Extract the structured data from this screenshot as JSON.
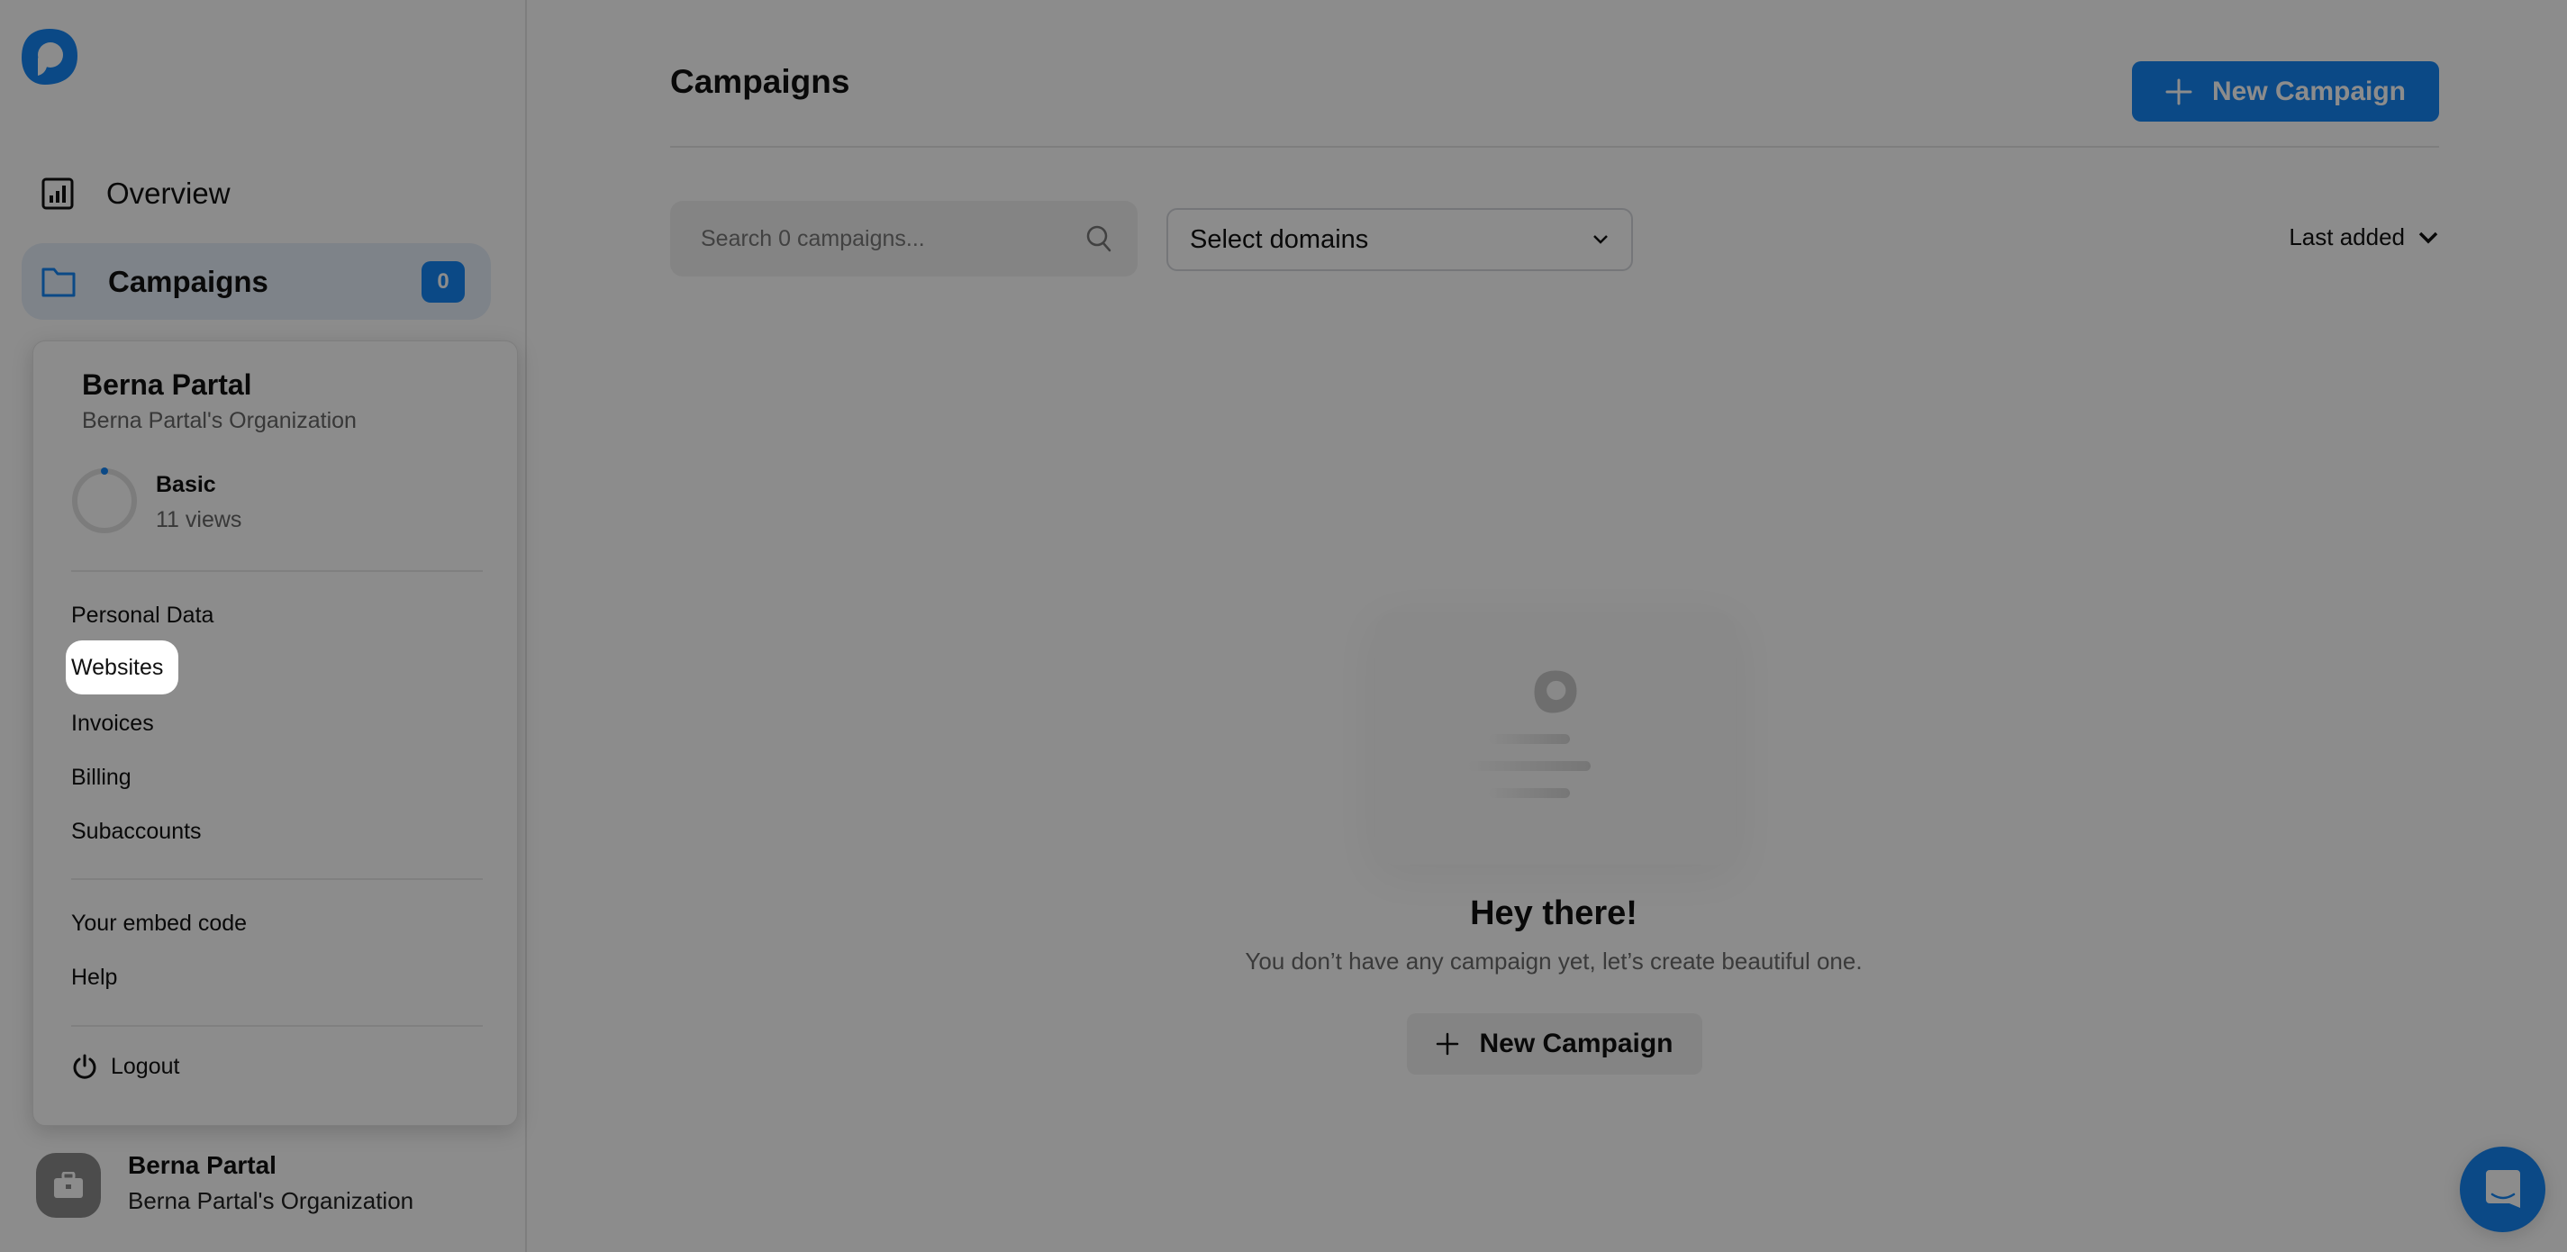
{
  "colors": {
    "accent": "#1586f5",
    "overlay": "rgba(0,0,0,0.45)"
  },
  "sidebar": {
    "logo": "brand-logo",
    "items": [
      {
        "label": "Overview",
        "icon": "chart-icon"
      },
      {
        "label": "Campaigns",
        "icon": "folder-icon",
        "badge": "0",
        "active": true
      }
    ],
    "user": {
      "name": "Berna Partal",
      "org": "Berna Partal's Organization",
      "icon": "briefcase-icon"
    }
  },
  "popup": {
    "name": "Berna Partal",
    "org": "Berna Partal's Organization",
    "plan": "Basic",
    "views": "11 views",
    "usage_fraction": 0.01,
    "menu1": [
      "Personal Data",
      "Websites",
      "Invoices",
      "Billing",
      "Subaccounts"
    ],
    "highlighted": "Websites",
    "menu2": [
      "Your embed code",
      "Help"
    ],
    "logout": "Logout"
  },
  "main": {
    "title": "Campaigns",
    "new_button": "New Campaign",
    "search_placeholder": "Search 0 campaigns...",
    "select_domains": "Select domains",
    "sort": "Last added",
    "empty": {
      "title": "Hey there!",
      "subtitle": "You don’t have any campaign yet, let’s create beautiful one.",
      "button": "New Campaign"
    }
  },
  "chat_icon": "chat-smile-icon"
}
